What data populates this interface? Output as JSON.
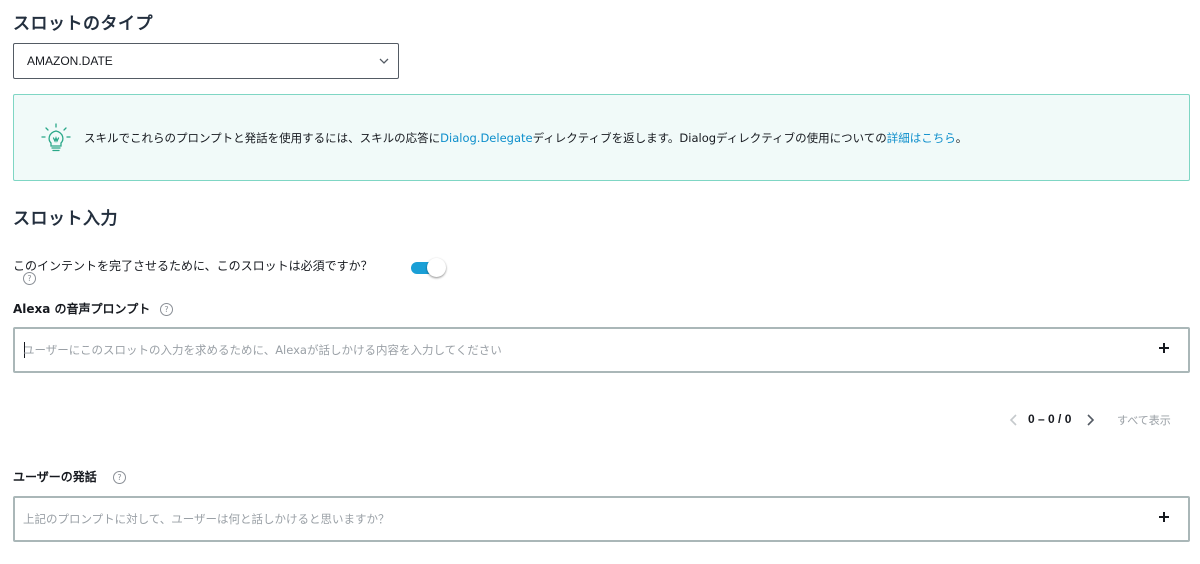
{
  "slot_type": {
    "title": "スロットのタイプ",
    "selected": "AMAZON.DATE"
  },
  "info": {
    "text_before": "スキルでこれらのプロンプトと発話を使用するには、スキルの応答に",
    "link1": "Dialog.Delegate",
    "text_middle": "ディレクティブを返します。Dialogディレクティブの使用についての",
    "link2": "詳細はこちら",
    "text_end": "。"
  },
  "slot_input": {
    "title": "スロット入力",
    "required_question": "このインテントを完了させるために、このスロットは必須ですか？",
    "required_toggle": "on",
    "prompt_label": "Alexa の音声プロンプト",
    "prompt_placeholder": "ユーザーにこのスロットの入力を求めるために、Alexaが話しかける内容を入力してください",
    "pager_text": "0 – 0 / 0",
    "show_all": "すべて表示",
    "utterance_label": "ユーザーの発話",
    "utterance_placeholder": "上記のプロンプトに対して、ユーザーは何と話しかけると思いますか？",
    "help_glyph": "?"
  },
  "colors": {
    "accent": "#1a9fd6",
    "link": "#0e8fcc",
    "info_bg": "#f1faf9",
    "info_border": "#7fd6c4"
  }
}
